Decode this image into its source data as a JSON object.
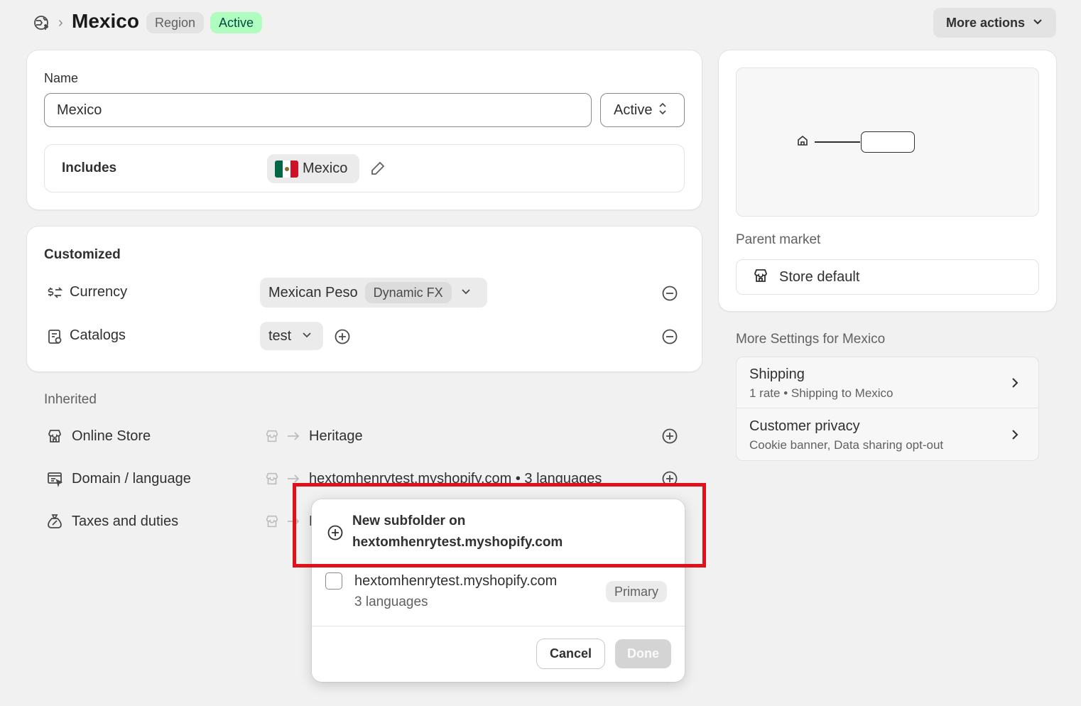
{
  "header": {
    "title": "Mexico",
    "badge_region": "Region",
    "badge_status": "Active",
    "more_actions": "More actions"
  },
  "name_card": {
    "name_label": "Name",
    "name_value": "Mexico",
    "status_select": "Active",
    "includes_label": "Includes",
    "includes_country": "Mexico"
  },
  "customized": {
    "heading": "Customized",
    "currency_label": "Currency",
    "currency_value": "Mexican Peso",
    "currency_badge": "Dynamic FX",
    "catalogs_label": "Catalogs",
    "catalogs_value": "test"
  },
  "inherited": {
    "heading": "Inherited",
    "online_store_label": "Online Store",
    "online_store_value": "Heritage",
    "domain_label": "Domain / language",
    "domain_value": "hextomhenrytest.myshopify.com • 3 languages",
    "taxes_label": "Taxes and duties",
    "taxes_value_partial": "N"
  },
  "sidebar": {
    "parent_market_label": "Parent market",
    "parent_market_value": "Store default",
    "more_settings_heading": "More Settings for Mexico",
    "settings": [
      {
        "title": "Shipping",
        "subtitle": "1 rate • Shipping to Mexico"
      },
      {
        "title": "Customer privacy",
        "subtitle": "Cookie banner, Data sharing opt-out"
      }
    ]
  },
  "popover": {
    "new_subfolder_line1": "New subfolder on",
    "new_subfolder_line2": "hextomhenrytest.myshopify.com",
    "domain_option": "hextomhenrytest.myshopify.com",
    "domain_option_sub": "3 languages",
    "primary_badge": "Primary",
    "cancel": "Cancel",
    "done": "Done"
  },
  "colors": {
    "highlight_border": "#e0111b",
    "active_badge_bg": "#affebf",
    "active_badge_text": "#014b40"
  }
}
